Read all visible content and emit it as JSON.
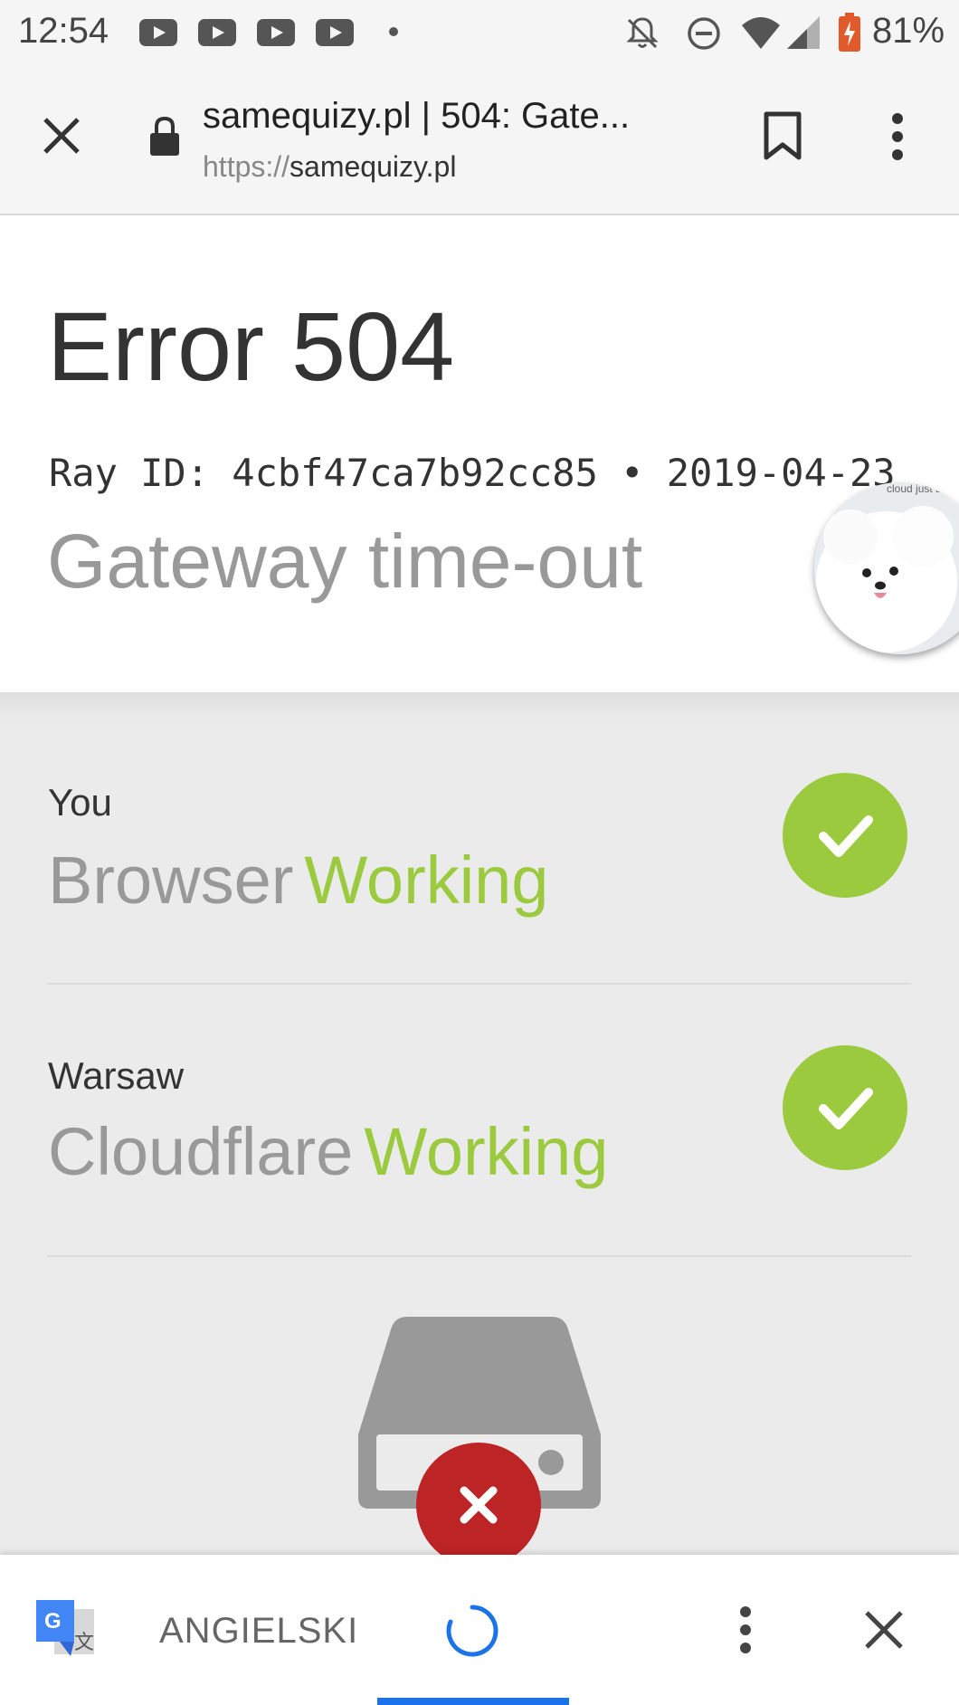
{
  "status_bar": {
    "time": "12:54",
    "notification_icons": [
      "youtube-icon",
      "youtube-icon",
      "youtube-icon",
      "youtube-icon"
    ],
    "system_icons": [
      "notifications-off-icon",
      "do-not-disturb-icon",
      "wifi-icon",
      "cell-signal-icon",
      "battery-charging-icon"
    ],
    "battery": "81%"
  },
  "browser": {
    "page_title": "samequizy.pl | 504: Gate...",
    "url_protocol": "https://",
    "url_host": "samequizy.pl"
  },
  "error": {
    "title": "Error 504",
    "ray_line": "Ray ID: 4cbf47ca7b92cc85 • 2019-04-23",
    "subtitle": "Gateway time-out",
    "bubble_caption": "cloud just ba"
  },
  "status_rows": [
    {
      "location": "You",
      "name": "Browser",
      "status": "Working"
    },
    {
      "location": "Warsaw",
      "name": "Cloudflare",
      "status": "Working"
    }
  ],
  "translate_bar": {
    "language": "ANGIELSKI"
  },
  "colors": {
    "working_green": "#9bca3e",
    "error_red": "#bd2426",
    "accent_blue": "#1a73e8"
  }
}
